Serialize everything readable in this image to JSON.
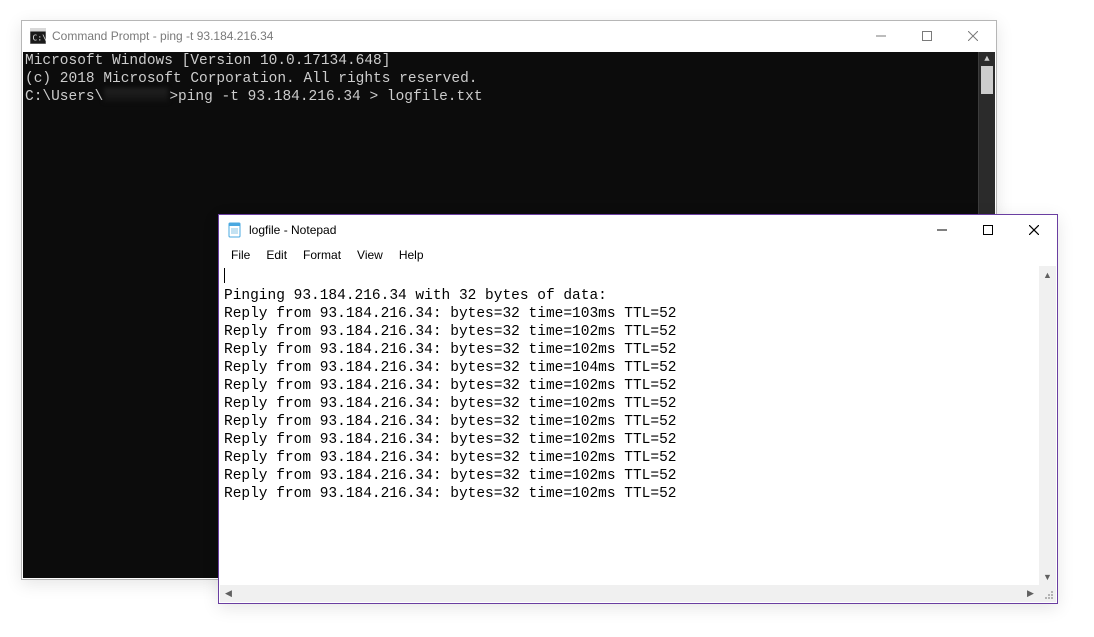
{
  "cmd": {
    "title": "Command Prompt - ping  -t 93.184.216.34",
    "lines": {
      "l1": "Microsoft Windows [Version 10.0.17134.648]",
      "l2": "(c) 2018 Microsoft Corporation. All rights reserved.",
      "l3": "",
      "prompt_pre": "C:\\Users\\",
      "prompt_post": ">ping -t 93.184.216.34 > logfile.txt"
    }
  },
  "notepad": {
    "title": "logfile - Notepad",
    "menu": {
      "file": "File",
      "edit": "Edit",
      "format": "Format",
      "view": "View",
      "help": "Help"
    },
    "body_header": "Pinging 93.184.216.34 with 32 bytes of data:",
    "replies": [
      "Reply from 93.184.216.34: bytes=32 time=103ms TTL=52",
      "Reply from 93.184.216.34: bytes=32 time=102ms TTL=52",
      "Reply from 93.184.216.34: bytes=32 time=102ms TTL=52",
      "Reply from 93.184.216.34: bytes=32 time=104ms TTL=52",
      "Reply from 93.184.216.34: bytes=32 time=102ms TTL=52",
      "Reply from 93.184.216.34: bytes=32 time=102ms TTL=52",
      "Reply from 93.184.216.34: bytes=32 time=102ms TTL=52",
      "Reply from 93.184.216.34: bytes=32 time=102ms TTL=52",
      "Reply from 93.184.216.34: bytes=32 time=102ms TTL=52",
      "Reply from 93.184.216.34: bytes=32 time=102ms TTL=52",
      "Reply from 93.184.216.34: bytes=32 time=102ms TTL=52"
    ]
  }
}
